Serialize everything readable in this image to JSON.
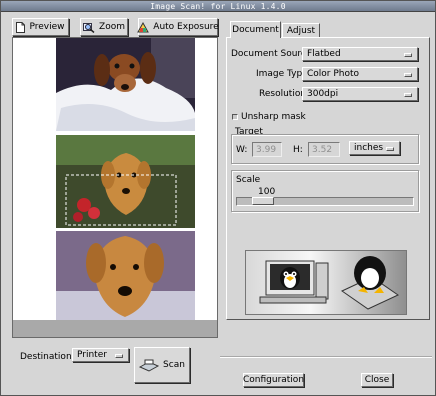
{
  "window": {
    "title": "Image Scan! for Linux 1.4.0"
  },
  "toolbar": {
    "preview_label": "Preview",
    "zoom_label": "Zoom",
    "auto_exposure_label": "Auto Exposure"
  },
  "tabs": {
    "document_label": "Document",
    "adjust_label": "Adjust"
  },
  "document": {
    "source_label": "Document Source:",
    "source_value": "Flatbed",
    "image_type_label": "Image Type:",
    "image_type_value": "Color Photo",
    "resolution_label": "Resolution:",
    "resolution_value": "300dpi",
    "unsharp_label": "Unsharp mask",
    "unsharp_checked": false
  },
  "target": {
    "group_label": "Target",
    "w_label": "W:",
    "w_value": "3.99",
    "h_label": "H:",
    "h_value": "3.52",
    "unit_value": "inches"
  },
  "scale": {
    "group_label": "Scale",
    "value_text": "100",
    "level": 0.1
  },
  "bottom": {
    "destination_label": "Destination:",
    "destination_value": "Printer",
    "scan_label": "Scan",
    "configuration_label": "Configuration",
    "close_label": "Close"
  },
  "colors": {
    "window_bg": "#d6d6d6",
    "titlebar": "#6f7b8e",
    "preview_bg": "#ffffff"
  },
  "icons": {
    "preview": "document-icon",
    "zoom": "magnifier-icon",
    "auto_exposure": "color-swatch-icon",
    "scan": "scanner-icon",
    "logo": "tux-penguin-computer-logo"
  }
}
